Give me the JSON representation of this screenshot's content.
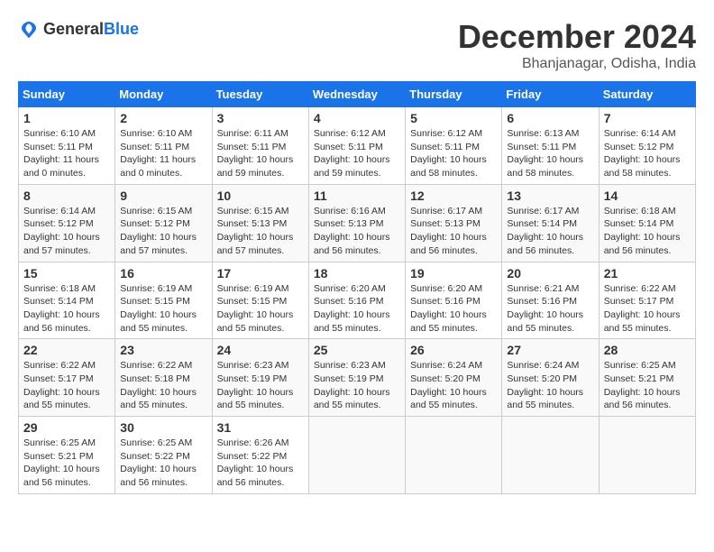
{
  "logo": {
    "text_general": "General",
    "text_blue": "Blue"
  },
  "title": {
    "month": "December 2024",
    "location": "Bhanjanagar, Odisha, India"
  },
  "weekdays": [
    "Sunday",
    "Monday",
    "Tuesday",
    "Wednesday",
    "Thursday",
    "Friday",
    "Saturday"
  ],
  "weeks": [
    [
      {
        "day": "1",
        "sunrise": "6:10 AM",
        "sunset": "5:11 PM",
        "daylight": "11 hours and 0 minutes."
      },
      {
        "day": "2",
        "sunrise": "6:10 AM",
        "sunset": "5:11 PM",
        "daylight": "11 hours and 0 minutes."
      },
      {
        "day": "3",
        "sunrise": "6:11 AM",
        "sunset": "5:11 PM",
        "daylight": "10 hours and 59 minutes."
      },
      {
        "day": "4",
        "sunrise": "6:12 AM",
        "sunset": "5:11 PM",
        "daylight": "10 hours and 59 minutes."
      },
      {
        "day": "5",
        "sunrise": "6:12 AM",
        "sunset": "5:11 PM",
        "daylight": "10 hours and 58 minutes."
      },
      {
        "day": "6",
        "sunrise": "6:13 AM",
        "sunset": "5:11 PM",
        "daylight": "10 hours and 58 minutes."
      },
      {
        "day": "7",
        "sunrise": "6:14 AM",
        "sunset": "5:12 PM",
        "daylight": "10 hours and 58 minutes."
      }
    ],
    [
      {
        "day": "8",
        "sunrise": "6:14 AM",
        "sunset": "5:12 PM",
        "daylight": "10 hours and 57 minutes."
      },
      {
        "day": "9",
        "sunrise": "6:15 AM",
        "sunset": "5:12 PM",
        "daylight": "10 hours and 57 minutes."
      },
      {
        "day": "10",
        "sunrise": "6:15 AM",
        "sunset": "5:13 PM",
        "daylight": "10 hours and 57 minutes."
      },
      {
        "day": "11",
        "sunrise": "6:16 AM",
        "sunset": "5:13 PM",
        "daylight": "10 hours and 56 minutes."
      },
      {
        "day": "12",
        "sunrise": "6:17 AM",
        "sunset": "5:13 PM",
        "daylight": "10 hours and 56 minutes."
      },
      {
        "day": "13",
        "sunrise": "6:17 AM",
        "sunset": "5:14 PM",
        "daylight": "10 hours and 56 minutes."
      },
      {
        "day": "14",
        "sunrise": "6:18 AM",
        "sunset": "5:14 PM",
        "daylight": "10 hours and 56 minutes."
      }
    ],
    [
      {
        "day": "15",
        "sunrise": "6:18 AM",
        "sunset": "5:14 PM",
        "daylight": "10 hours and 56 minutes."
      },
      {
        "day": "16",
        "sunrise": "6:19 AM",
        "sunset": "5:15 PM",
        "daylight": "10 hours and 55 minutes."
      },
      {
        "day": "17",
        "sunrise": "6:19 AM",
        "sunset": "5:15 PM",
        "daylight": "10 hours and 55 minutes."
      },
      {
        "day": "18",
        "sunrise": "6:20 AM",
        "sunset": "5:16 PM",
        "daylight": "10 hours and 55 minutes."
      },
      {
        "day": "19",
        "sunrise": "6:20 AM",
        "sunset": "5:16 PM",
        "daylight": "10 hours and 55 minutes."
      },
      {
        "day": "20",
        "sunrise": "6:21 AM",
        "sunset": "5:16 PM",
        "daylight": "10 hours and 55 minutes."
      },
      {
        "day": "21",
        "sunrise": "6:22 AM",
        "sunset": "5:17 PM",
        "daylight": "10 hours and 55 minutes."
      }
    ],
    [
      {
        "day": "22",
        "sunrise": "6:22 AM",
        "sunset": "5:17 PM",
        "daylight": "10 hours and 55 minutes."
      },
      {
        "day": "23",
        "sunrise": "6:22 AM",
        "sunset": "5:18 PM",
        "daylight": "10 hours and 55 minutes."
      },
      {
        "day": "24",
        "sunrise": "6:23 AM",
        "sunset": "5:19 PM",
        "daylight": "10 hours and 55 minutes."
      },
      {
        "day": "25",
        "sunrise": "6:23 AM",
        "sunset": "5:19 PM",
        "daylight": "10 hours and 55 minutes."
      },
      {
        "day": "26",
        "sunrise": "6:24 AM",
        "sunset": "5:20 PM",
        "daylight": "10 hours and 55 minutes."
      },
      {
        "day": "27",
        "sunrise": "6:24 AM",
        "sunset": "5:20 PM",
        "daylight": "10 hours and 55 minutes."
      },
      {
        "day": "28",
        "sunrise": "6:25 AM",
        "sunset": "5:21 PM",
        "daylight": "10 hours and 56 minutes."
      }
    ],
    [
      {
        "day": "29",
        "sunrise": "6:25 AM",
        "sunset": "5:21 PM",
        "daylight": "10 hours and 56 minutes."
      },
      {
        "day": "30",
        "sunrise": "6:25 AM",
        "sunset": "5:22 PM",
        "daylight": "10 hours and 56 minutes."
      },
      {
        "day": "31",
        "sunrise": "6:26 AM",
        "sunset": "5:22 PM",
        "daylight": "10 hours and 56 minutes."
      },
      null,
      null,
      null,
      null
    ]
  ]
}
